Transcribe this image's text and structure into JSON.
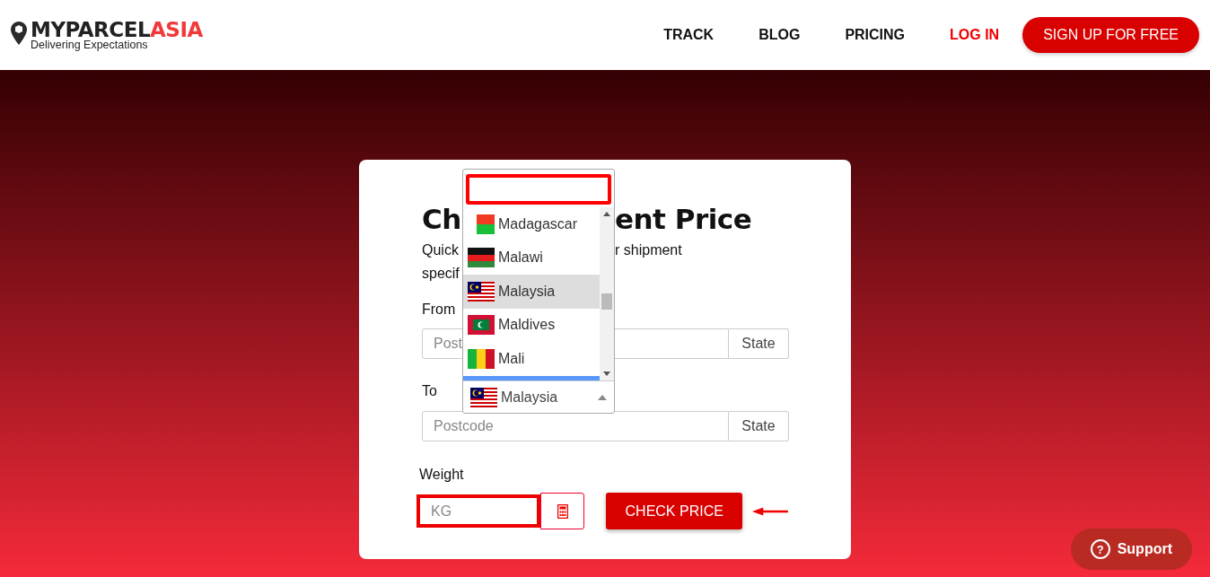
{
  "header": {
    "logo": {
      "brand_dark": "MYPARCEL",
      "brand_red": "ASIA",
      "tagline": "Delivering Expectations"
    },
    "nav": [
      {
        "label": "TRACK",
        "kind": "link"
      },
      {
        "label": "BLOG",
        "kind": "link"
      },
      {
        "label": "PRICING",
        "kind": "link"
      },
      {
        "label": "LOG IN",
        "kind": "accent"
      },
      {
        "label": "SIGN UP FOR FREE",
        "kind": "pill"
      }
    ]
  },
  "card": {
    "title_start": "Ch",
    "title_end": "ent Price",
    "description_start": "Quick",
    "description_end": "r shipment",
    "description_line2": "specif",
    "from": {
      "label": "From",
      "placeholder": "Post",
      "addon": "State"
    },
    "to": {
      "label": "To",
      "placeholder": "Postcode",
      "addon": "State"
    },
    "weight": {
      "label": "Weight",
      "placeholder": "KG"
    },
    "check_button": "CHECK PRICE"
  },
  "country_dropdown": {
    "options": [
      {
        "label": "Madagascar",
        "kind": "madagascar",
        "selected": false
      },
      {
        "label": "Malawi",
        "kind": "malawi",
        "selected": false
      },
      {
        "label": "Malaysia",
        "kind": "malaysia",
        "selected": true
      },
      {
        "label": "Maldives",
        "kind": "maldives",
        "selected": false
      },
      {
        "label": "Mali",
        "kind": "mali",
        "selected": false
      }
    ],
    "value": {
      "label": "Malaysia",
      "kind": "malaysia"
    }
  },
  "support_button": {
    "icon": "?",
    "label": "Support"
  }
}
